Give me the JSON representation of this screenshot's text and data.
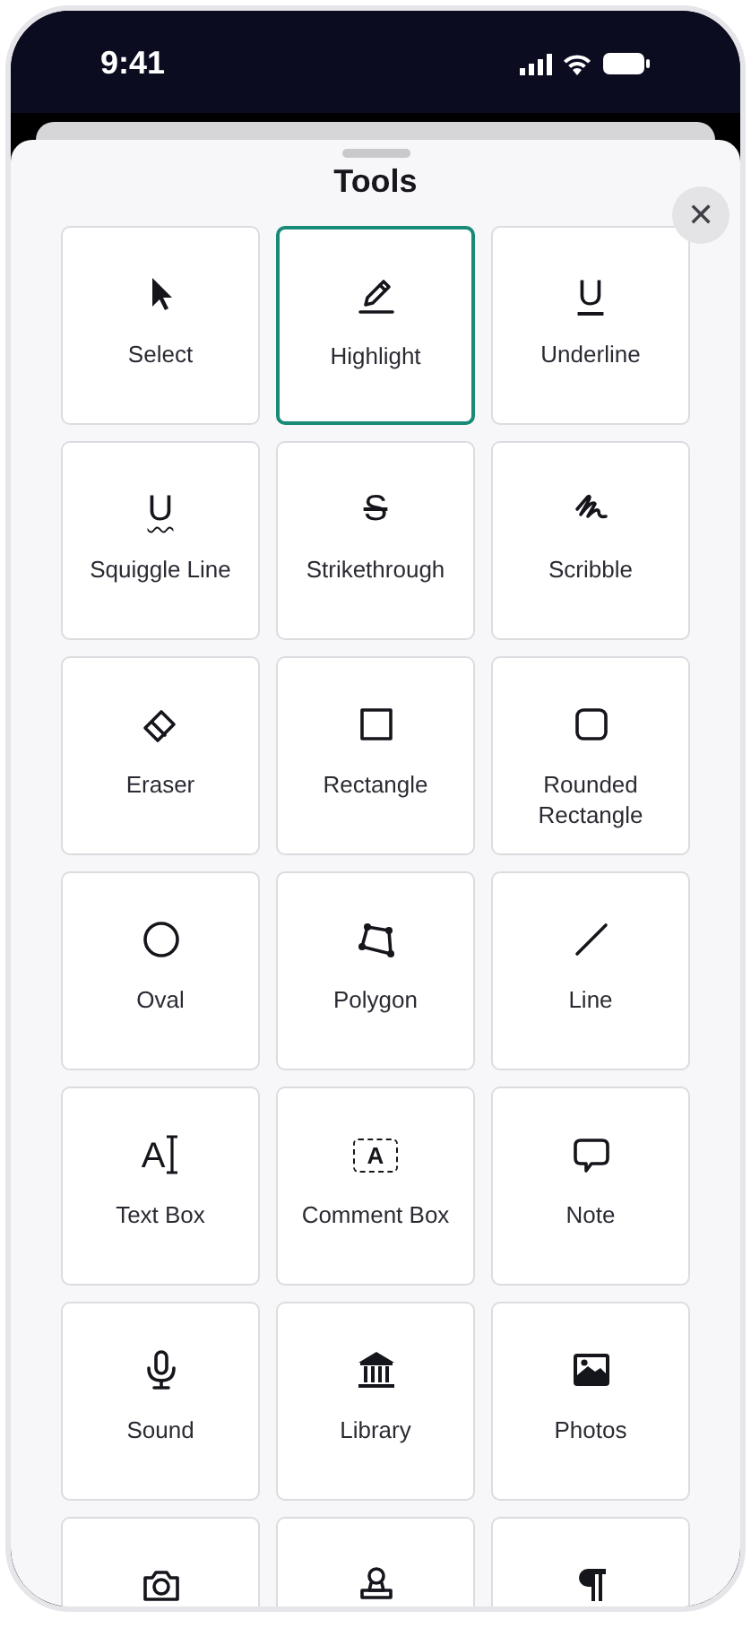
{
  "status_bar": {
    "time": "9:41"
  },
  "sheet": {
    "title": "Tools",
    "close_label": "✕"
  },
  "tools": [
    {
      "label": "Select",
      "selected": false
    },
    {
      "label": "Highlight",
      "selected": true
    },
    {
      "label": "Underline",
      "selected": false,
      "glyph": "U"
    },
    {
      "label": "Squiggle Line",
      "selected": false,
      "glyph": "U"
    },
    {
      "label": "Strikethrough",
      "selected": false,
      "glyph": "S"
    },
    {
      "label": "Scribble",
      "selected": false
    },
    {
      "label": "Eraser",
      "selected": false
    },
    {
      "label": "Rectangle",
      "selected": false
    },
    {
      "label": "Rounded Rectangle",
      "selected": false
    },
    {
      "label": "Oval",
      "selected": false
    },
    {
      "label": "Polygon",
      "selected": false
    },
    {
      "label": "Line",
      "selected": false
    },
    {
      "label": "Text Box",
      "selected": false,
      "glyph": "A"
    },
    {
      "label": "Comment Box",
      "selected": false,
      "glyph": "A"
    },
    {
      "label": "Note",
      "selected": false
    },
    {
      "label": "Sound",
      "selected": false
    },
    {
      "label": "Library",
      "selected": false
    },
    {
      "label": "Photos",
      "selected": false
    },
    {
      "selected": false
    },
    {
      "selected": false
    },
    {
      "selected": false
    }
  ]
}
